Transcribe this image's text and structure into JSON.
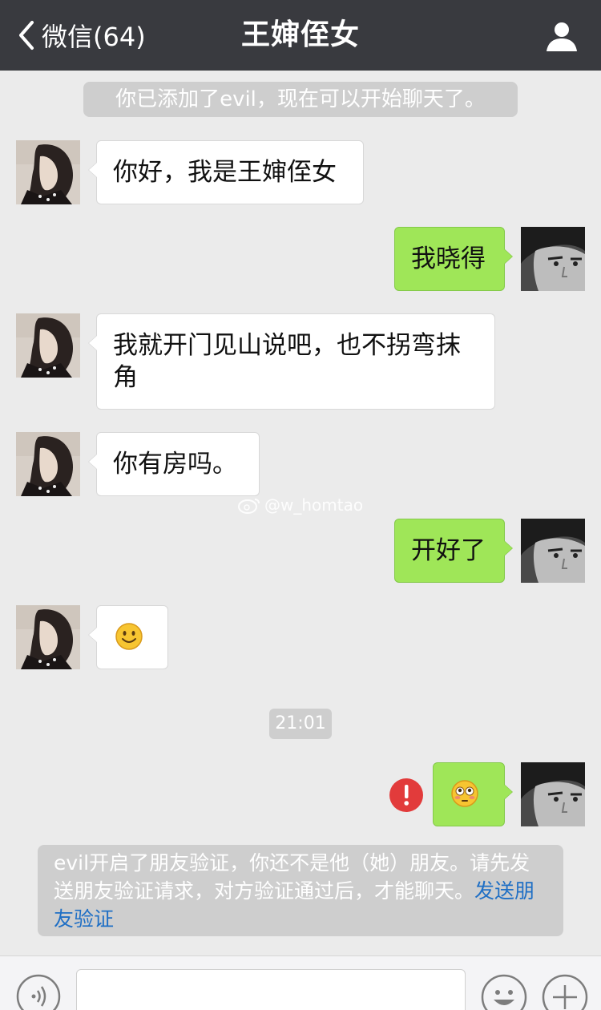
{
  "header": {
    "back_label": "微信(64)",
    "title": "王婶侄女"
  },
  "system_notice": "你已添加了evil，现在可以开始聊天了。",
  "messages": [
    {
      "from": "her",
      "text": "你好，我是王婶侄女"
    },
    {
      "from": "me",
      "text": "我晓得"
    },
    {
      "from": "her",
      "text": "我就开门见山说吧，也不拐弯抹角"
    },
    {
      "from": "her",
      "text": "你有房吗。"
    },
    {
      "from": "me",
      "text": "开好了"
    },
    {
      "from": "her",
      "emoji": "smile-emoji"
    },
    {
      "from": "me",
      "emoji": "flushed-emoji",
      "status": "failed"
    }
  ],
  "watermark": "@w_homtao",
  "timestamp": "21:01",
  "verify_notice": {
    "text": "evil开启了朋友验证，你还不是他（她）朋友。请先发送朋友验证请求，对方验证通过后，才能聊天。",
    "link": "发送朋友验证"
  },
  "input": {
    "placeholder": ""
  },
  "icons": {
    "back": "chevron-left-icon",
    "profile": "person-icon",
    "voice": "voice-icon",
    "emoji": "emoji-icon",
    "plus": "plus-icon",
    "error": "error-icon"
  },
  "colors": {
    "topbar": "#393a3f",
    "outgoing_bubble": "#9fe658",
    "incoming_bubble": "#ffffff",
    "chat_bg": "#ebebeb",
    "link": "#1f6fc5",
    "error": "#e23b3b"
  }
}
